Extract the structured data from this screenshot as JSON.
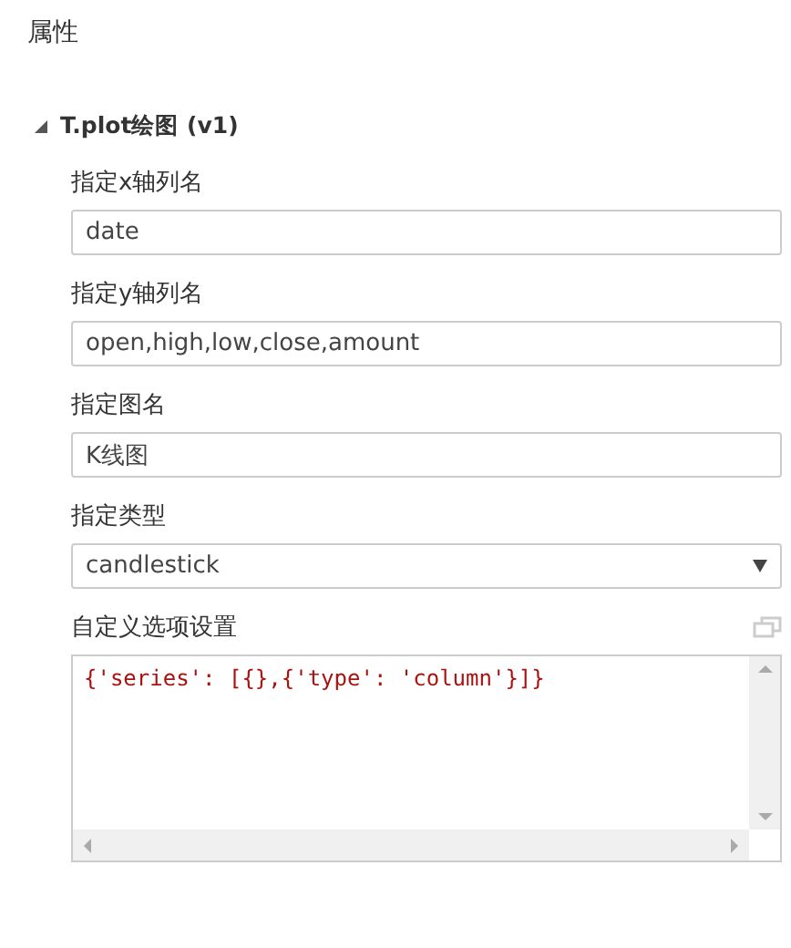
{
  "panel": {
    "title": "属性"
  },
  "section": {
    "title": "T.plot绘图 (v1)",
    "expanded": true,
    "fields": [
      {
        "kind": "text",
        "label": "指定x轴列名",
        "value": "date"
      },
      {
        "kind": "text",
        "label": "指定y轴列名",
        "value": "open,high,low,close,amount"
      },
      {
        "kind": "text",
        "label": "指定图名",
        "value": "K线图"
      },
      {
        "kind": "select",
        "label": "指定类型",
        "value": "candlestick"
      },
      {
        "kind": "code",
        "label": "自定义选项设置",
        "value": "{'series': [{},{'type': 'column'}]}"
      }
    ]
  }
}
